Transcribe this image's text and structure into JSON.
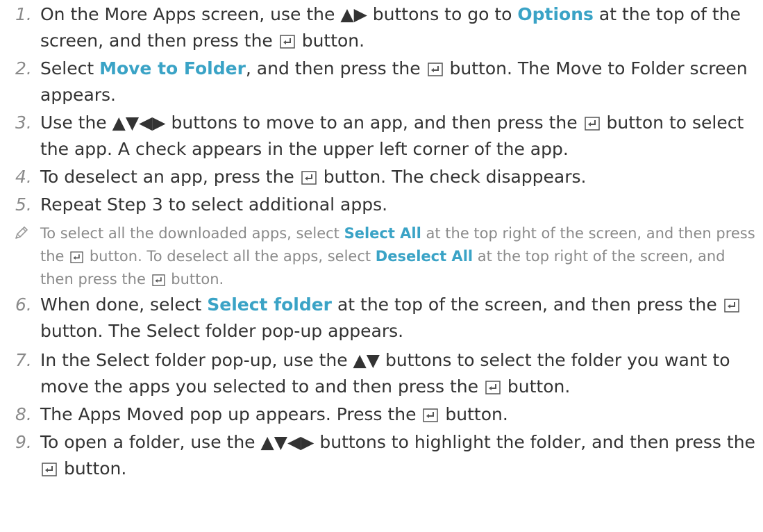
{
  "steps": [
    {
      "num": "1.",
      "text": "On the More Apps screen, use the ▲▶ buttons to go to [Options] at the top of the screen, and then press the {E} button."
    },
    {
      "num": "2.",
      "text": "Select [Move to Folder], and then press the {E} button. The Move to Folder screen appears."
    },
    {
      "num": "3.",
      "text": "Use the ▲▼◀▶ buttons to move to an app, and then press the {E} button to select the app. A check appears in the upper left corner of the app."
    },
    {
      "num": "4.",
      "text": "To deselect an app, press the {E} button. The check disappears."
    },
    {
      "num": "5.",
      "text": "Repeat Step 3 to select additional apps."
    },
    {
      "num": "6.",
      "text": "When done, select [Select folder] at the top of the screen, and then press the {E} button. The Select folder pop-up appears."
    },
    {
      "num": "7.",
      "text": "In the Select folder pop-up, use the ▲▼ buttons to select the folder you want to move the apps you selected to and then press the {E} button."
    },
    {
      "num": "8.",
      "text": "The Apps Moved pop up appears. Press the {E} button."
    },
    {
      "num": "9.",
      "text": "To open a folder, use the ▲▼◀▶ buttons to highlight the folder, and then press the {E} button."
    }
  ],
  "note": {
    "icon": "pencil-icon",
    "text": "To select all the downloaded apps, select [Select All] at the top right of the screen, and then press the {E} button. To deselect all the apps, select [Deselect All] at the top right of the screen, and then press the {E} button."
  },
  "colors": {
    "highlight": "#3aa3c6",
    "text": "#333333",
    "muted": "#8a8a8a"
  }
}
